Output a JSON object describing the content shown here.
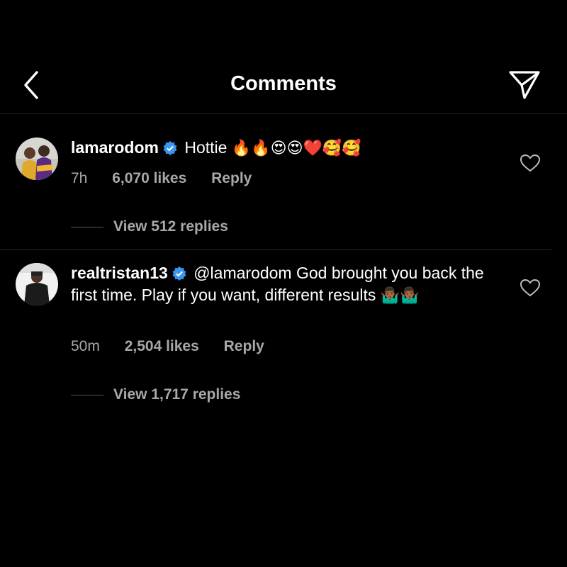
{
  "header": {
    "title": "Comments",
    "back_icon": "chevron-left-icon",
    "share_icon": "paper-plane-icon"
  },
  "comments": [
    {
      "username": "lamarodom",
      "verified": true,
      "text": "Hottie",
      "emojis": "🔥🔥😍😍❤️🥰🥰",
      "time": "7h",
      "likes": "6,070 likes",
      "reply": "Reply",
      "view_replies": "View 512 replies"
    },
    {
      "username": "realtristan13",
      "verified": true,
      "mention": "@lamarodom",
      "text": "God brought you back the first time. Play if you want, different results",
      "emojis": "🤷🏾‍♂️🤷🏾‍♂️",
      "time": "50m",
      "likes": "2,504 likes",
      "reply": "Reply",
      "view_replies": "View 1,717 replies"
    }
  ],
  "colors": {
    "background": "#000000",
    "text": "#ffffff",
    "secondary": "#a8a8a8",
    "verified": "#3897f0"
  }
}
